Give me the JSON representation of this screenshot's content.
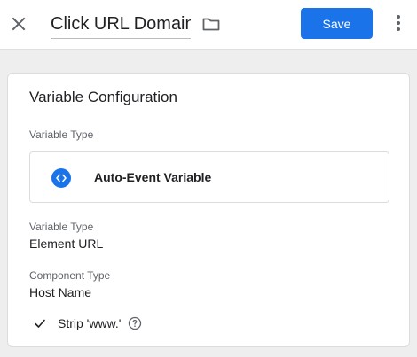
{
  "header": {
    "title_value": "Click URL Domain",
    "save_label": "Save"
  },
  "config": {
    "card_title": "Variable Configuration",
    "variable_type_heading": "Variable Type",
    "selected_type": "Auto-Event Variable",
    "detail_type_label": "Variable Type",
    "detail_type_value": "Element URL",
    "component_type_label": "Component Type",
    "component_type_value": "Host Name",
    "strip_www_label": "Strip 'www.'",
    "strip_www_checked": true
  },
  "colors": {
    "accent": "#1a73e8",
    "background": "#eeeeee"
  },
  "icons": {
    "close": "close-icon",
    "folder": "folder-icon",
    "more": "more-vert-icon",
    "type": "code-brackets-icon",
    "check": "check-icon",
    "help": "help-circle-icon"
  }
}
